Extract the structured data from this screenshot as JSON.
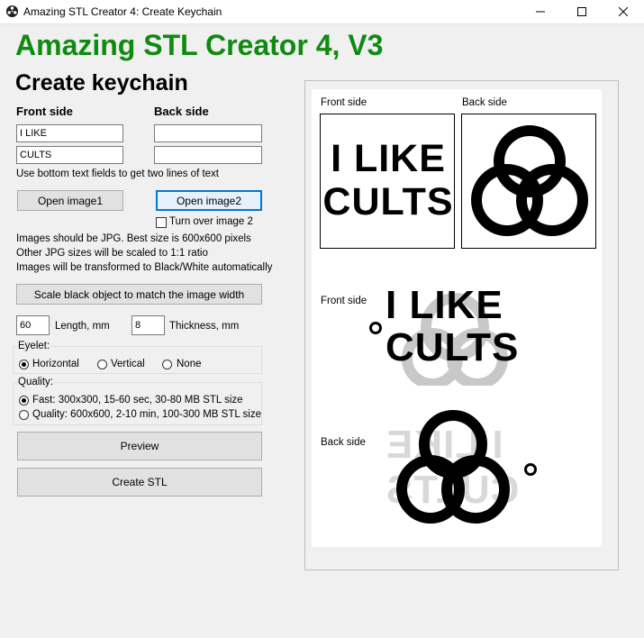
{
  "window": {
    "title": "Amazing STL Creator 4: Create Keychain",
    "minimize_glyph": "—",
    "maximize_glyph": "☐",
    "close_glyph": "✕"
  },
  "app": {
    "headline": "Amazing STL Creator 4, V3",
    "subheading": "Create keychain",
    "brand_color": "#108a10"
  },
  "front": {
    "label": "Front side",
    "line1": "I LIKE",
    "line2": "CULTS"
  },
  "back": {
    "label": "Back side",
    "line1": "",
    "line2": ""
  },
  "hint_two_lines": "Use bottom text fields to get two lines of text",
  "buttons": {
    "open_image1": "Open image1",
    "open_image2": "Open image2",
    "scale": "Scale black object to match the image width",
    "preview": "Preview",
    "create_stl": "Create STL"
  },
  "turn_over": {
    "label": "Turn over image 2",
    "checked": false
  },
  "info": [
    "Images should be JPG. Best size is 600x600 pixels",
    "Other JPG sizes will be scaled to 1:1 ratio",
    "Images will be transformed to Black/White automatically"
  ],
  "dimensions": {
    "length_value": "60",
    "length_label": "Length, mm",
    "thickness_value": "8",
    "thickness_label": "Thickness, mm"
  },
  "eyelet": {
    "title": "Eyelet:",
    "options": [
      "Horizontal",
      "Vertical",
      "None"
    ],
    "selected": "Horizontal"
  },
  "quality": {
    "title": "Quality:",
    "options": [
      "Fast: 300x300, 15-60 sec, 30-80 MB STL size",
      "Quality: 600x600, 2-10 min, 100-300 MB STL size"
    ],
    "selected": "Fast: 300x300, 15-60 sec, 30-80 MB STL size"
  },
  "preview": {
    "front_side_label": "Front side",
    "back_side_label": "Back side",
    "preview_front_label": "Front side",
    "preview_back_label": "Back side",
    "image_line1": "I LIKE",
    "image_line2": "CULTS"
  },
  "icons": {
    "app": "film-reel-icon",
    "back_image": "triple-spiral-icon"
  }
}
